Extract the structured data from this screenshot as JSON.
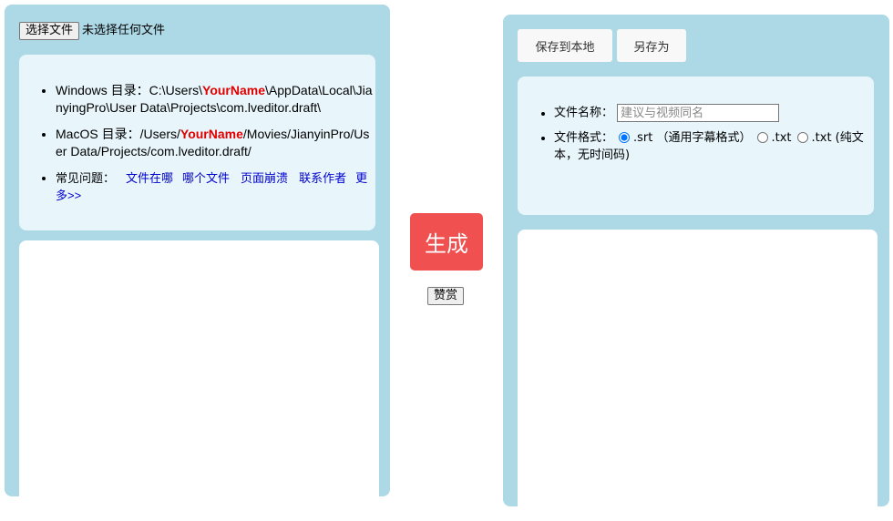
{
  "left": {
    "choose_file_label": "选择文件",
    "no_file_text": "未选择任何文件",
    "windows_prefix": "Windows 目录：C:\\Users\\",
    "windows_name": "YourName",
    "windows_suffix": "\\AppData\\Local\\JianyingPro\\User Data\\Projects\\com.lveditor.draft\\",
    "macos_prefix": "MacOS 目录：/Users/",
    "macos_name": "YourName",
    "macos_suffix": "/Movies/JianyinPro/User Data/Projects/com.lveditor.draft/",
    "faq_label": "常见问题：",
    "faq_links": [
      "文件在哪",
      "哪个文件",
      "页面崩溃",
      "联系作者",
      "更多>>"
    ]
  },
  "middle": {
    "generate_label": "生成",
    "donate_label": "赞赏"
  },
  "right": {
    "save_local_label": "保存到本地",
    "save_as_label": "另存为",
    "filename_label": "文件名称：",
    "filename_placeholder": "建议与视频同名",
    "format_label": "文件格式：",
    "format_options": [
      {
        "label": ".srt （通用字幕格式）",
        "checked": true
      },
      {
        "label": ".txt",
        "checked": false
      },
      {
        "label": ".txt (纯文本，无时间码)",
        "checked": false
      }
    ]
  },
  "colors": {
    "panel_bg": "#add8e6",
    "info_bg": "#e8f6fc",
    "generate_bg": "#f0504f",
    "highlight_red": "#e00000",
    "link_blue": "#0000cc"
  }
}
